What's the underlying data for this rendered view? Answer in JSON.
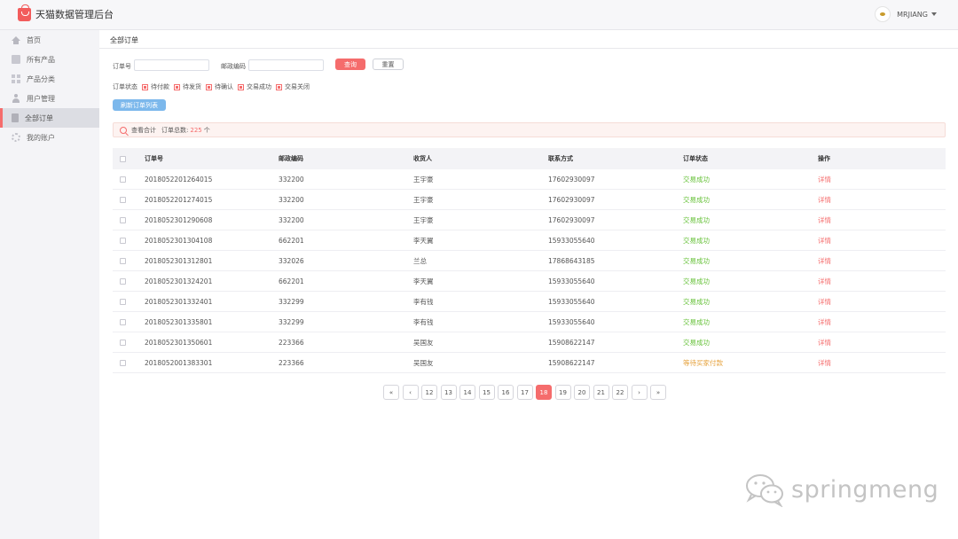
{
  "app": {
    "title": "天猫数据管理后台"
  },
  "user": {
    "name": "MRJIANG"
  },
  "sidebar": {
    "items": [
      {
        "label": "首页",
        "icon": "home-icon"
      },
      {
        "label": "所有产品",
        "icon": "product-icon"
      },
      {
        "label": "产品分类",
        "icon": "category-icon"
      },
      {
        "label": "用户管理",
        "icon": "user-icon"
      },
      {
        "label": "全部订单",
        "icon": "order-icon",
        "active": true
      },
      {
        "label": "我的账户",
        "icon": "gear-icon"
      }
    ]
  },
  "breadcrumb": "全部订单",
  "filters": {
    "order_no_label": "订单号",
    "order_no_value": "",
    "postcode_label": "邮政编码",
    "postcode_value": "",
    "query_button": "查询",
    "reset_button": "重置",
    "status_label": "订单状态",
    "statuses": [
      "待付款",
      "待发货",
      "待确认",
      "交易成功",
      "交易关闭"
    ],
    "refresh_button": "刷新订单列表"
  },
  "summary": {
    "prefix": "查看合计",
    "label": "订单总数:",
    "count": "225",
    "unit": "个"
  },
  "table": {
    "headers": [
      "订单号",
      "邮政编码",
      "收货人",
      "联系方式",
      "订单状态",
      "操作"
    ],
    "rows": [
      {
        "order_no": "2018052201264015",
        "postcode": "332200",
        "receiver": "王宇豪",
        "contact": "17602930097",
        "status": "交易成功",
        "action": "详情"
      },
      {
        "order_no": "2018052201274015",
        "postcode": "332200",
        "receiver": "王宇豪",
        "contact": "17602930097",
        "status": "交易成功",
        "action": "详情"
      },
      {
        "order_no": "2018052301290608",
        "postcode": "332200",
        "receiver": "王宇豪",
        "contact": "17602930097",
        "status": "交易成功",
        "action": "详情"
      },
      {
        "order_no": "2018052301304108",
        "postcode": "662201",
        "receiver": "李天翼",
        "contact": "15933055640",
        "status": "交易成功",
        "action": "详情"
      },
      {
        "order_no": "2018052301312801",
        "postcode": "332026",
        "receiver": "兰总",
        "contact": "17868643185",
        "status": "交易成功",
        "action": "详情"
      },
      {
        "order_no": "2018052301324201",
        "postcode": "662201",
        "receiver": "李天翼",
        "contact": "15933055640",
        "status": "交易成功",
        "action": "详情"
      },
      {
        "order_no": "2018052301332401",
        "postcode": "332299",
        "receiver": "李有钱",
        "contact": "15933055640",
        "status": "交易成功",
        "action": "详情"
      },
      {
        "order_no": "2018052301335801",
        "postcode": "332299",
        "receiver": "李有钱",
        "contact": "15933055640",
        "status": "交易成功",
        "action": "详情"
      },
      {
        "order_no": "2018052301350601",
        "postcode": "223366",
        "receiver": "吴国友",
        "contact": "15908622147",
        "status": "交易成功",
        "action": "详情"
      },
      {
        "order_no": "2018052001383301",
        "postcode": "223366",
        "receiver": "吴国友",
        "contact": "15908622147",
        "status": "等待买家付款",
        "action": "详情"
      }
    ]
  },
  "pagination": {
    "first": "«",
    "prev": "‹",
    "next": "›",
    "last": "»",
    "pages": [
      "12",
      "13",
      "14",
      "15",
      "16",
      "17",
      "18",
      "19",
      "20",
      "21",
      "22"
    ],
    "current": "18"
  },
  "watermark": {
    "text": "springmeng"
  },
  "colors": {
    "accent": "#f56c6c",
    "success": "#67c23a",
    "warning": "#e6a23c",
    "info": "#7cb8ec"
  }
}
